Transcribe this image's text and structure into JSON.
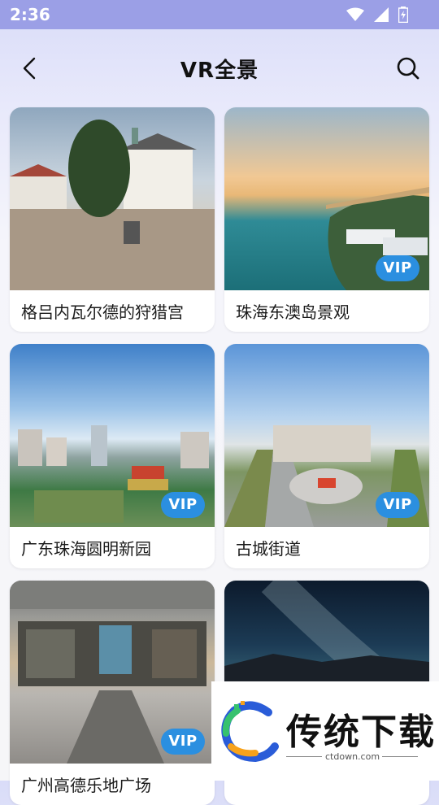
{
  "status_bar": {
    "time": "2:36"
  },
  "header": {
    "title": "VR全景"
  },
  "items": [
    {
      "title": "格吕内瓦尔德的狩猎宫",
      "vip": false
    },
    {
      "title": "珠海东澳岛景观",
      "vip": true,
      "badge": "VIP"
    },
    {
      "title": "广东珠海圆明新园",
      "vip": true,
      "badge": "VIP"
    },
    {
      "title": "古城街道",
      "vip": true,
      "badge": "VIP"
    },
    {
      "title": "广州高德乐地广场",
      "vip": true,
      "badge": "VIP"
    },
    {
      "title": "",
      "vip": false
    }
  ],
  "watermark": {
    "brand": "传统下载",
    "url": "ctdown.com"
  },
  "colors": {
    "accent": "#2b8fe0",
    "status_bar": "#9b9fe6",
    "background": "#f6f6f8"
  }
}
